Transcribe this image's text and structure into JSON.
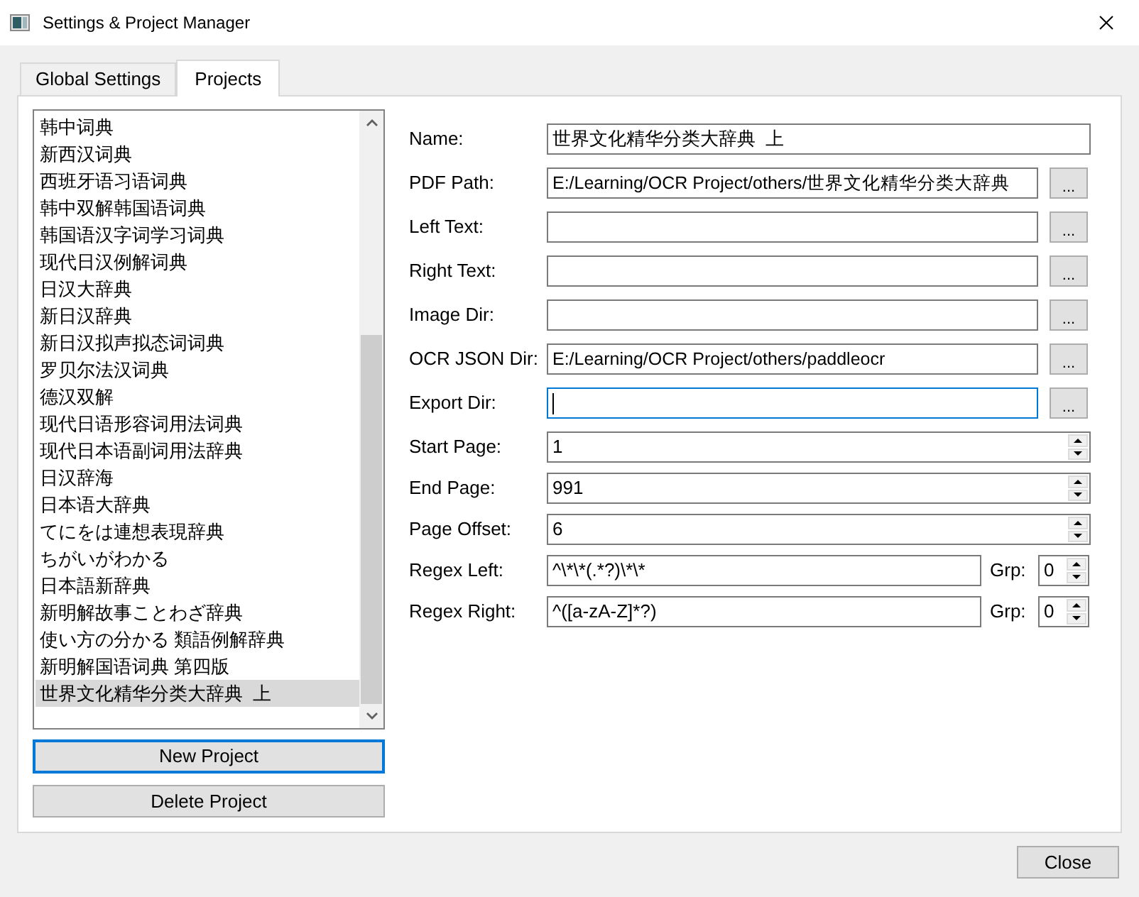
{
  "window": {
    "title": "Settings & Project Manager"
  },
  "tabs": [
    {
      "label": "Global Settings",
      "selected": false
    },
    {
      "label": "Projects",
      "selected": true
    }
  ],
  "project_list": {
    "items": [
      {
        "label": "韩中词典",
        "selected": false
      },
      {
        "label": "新西汉词典",
        "selected": false
      },
      {
        "label": "西班牙语习语词典",
        "selected": false
      },
      {
        "label": "韩中双解韩国语词典",
        "selected": false
      },
      {
        "label": "韩国语汉字词学习词典",
        "selected": false
      },
      {
        "label": "现代日汉例解词典",
        "selected": false
      },
      {
        "label": "日汉大辞典",
        "selected": false
      },
      {
        "label": "新日汉辞典",
        "selected": false
      },
      {
        "label": "新日汉拟声拟态词词典",
        "selected": false
      },
      {
        "label": "罗贝尔法汉词典",
        "selected": false
      },
      {
        "label": "德汉双解",
        "selected": false
      },
      {
        "label": "现代日语形容词用法词典",
        "selected": false
      },
      {
        "label": "现代日本语副词用法辞典",
        "selected": false
      },
      {
        "label": "日汉辞海",
        "selected": false
      },
      {
        "label": "日本语大辞典",
        "selected": false
      },
      {
        "label": "てにをは連想表現辞典",
        "selected": false
      },
      {
        "label": "ちがいがわかる",
        "selected": false
      },
      {
        "label": "日本語新辞典",
        "selected": false
      },
      {
        "label": "新明解故事ことわざ辞典",
        "selected": false
      },
      {
        "label": "使い方の分かる 類語例解辞典",
        "selected": false
      },
      {
        "label": "新明解国语词典 第四版",
        "selected": false
      },
      {
        "label": "世界文化精华分类大辞典  上",
        "selected": true
      }
    ]
  },
  "project_buttons": [
    {
      "label": "New Project",
      "focused": true
    },
    {
      "label": "Delete Project",
      "focused": false
    }
  ],
  "form": {
    "fields": [
      {
        "kind": "text",
        "label": "Name:",
        "value": "世界文化精华分类大辞典  上",
        "focused": false
      },
      {
        "kind": "path",
        "label": "PDF Path:",
        "value": "E:/Learning/OCR Project/others/世界文化精华分类大辞典",
        "button": "...",
        "focused": false
      },
      {
        "kind": "path",
        "label": "Left Text:",
        "button": "...",
        "focused": false
      },
      {
        "kind": "path",
        "label": "Right Text:",
        "button": "...",
        "focused": false
      },
      {
        "kind": "path",
        "label": "Image Dir:",
        "button": "...",
        "focused": false
      },
      {
        "kind": "path",
        "label": "OCR JSON Dir:",
        "value": "E:/Learning/OCR Project/others/paddleocr",
        "button": "...",
        "focused": false
      },
      {
        "kind": "path",
        "label": "Export Dir:",
        "button": "...",
        "focused": true
      },
      {
        "kind": "spin",
        "label": "Start Page:",
        "value": "1",
        "focused": false
      },
      {
        "kind": "spin",
        "label": "End Page:",
        "value": "991",
        "focused": false
      },
      {
        "kind": "spin",
        "label": "Page Offset:",
        "value": "6",
        "focused": false
      },
      {
        "kind": "regex",
        "label": "Regex Left:",
        "value": "^\\*\\*(.*?)\\*\\*",
        "group_label": "Grp:",
        "group_value": "0",
        "focused": false
      },
      {
        "kind": "regex",
        "label": "Regex Right:",
        "value": "^([a-zA-Z]*?)",
        "group_label": "Grp:",
        "group_value": "0",
        "focused": false
      }
    ]
  },
  "footer": {
    "close_button": "Close"
  }
}
